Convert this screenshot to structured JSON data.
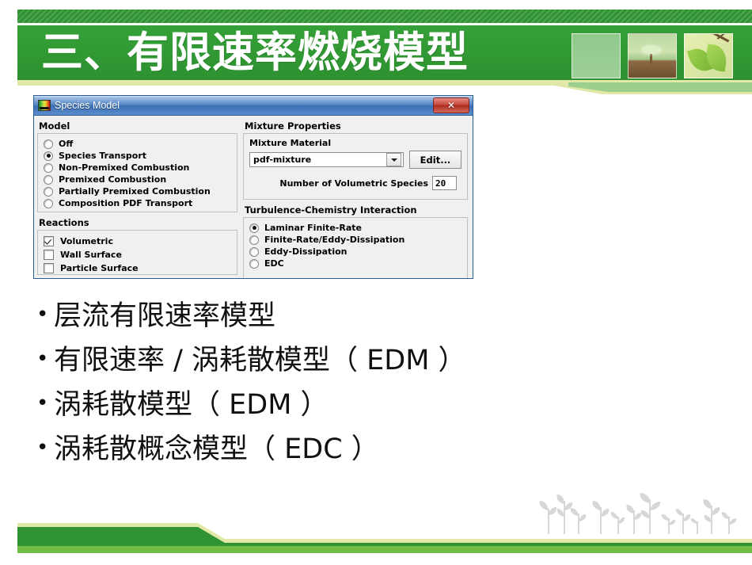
{
  "slide": {
    "title": "三、有限速率燃烧模型",
    "thumbnails": [
      {
        "name": "blank-panel"
      },
      {
        "name": "seedling-photo"
      },
      {
        "name": "leaf-photo"
      }
    ]
  },
  "dialog": {
    "title": "Species Model",
    "icon": "fluent-contour-icon",
    "close_label": "✕",
    "model": {
      "group_label": "Model",
      "options": [
        {
          "label": "Off",
          "selected": false
        },
        {
          "label": "Species Transport",
          "selected": true
        },
        {
          "label": "Non-Premixed Combustion",
          "selected": false
        },
        {
          "label": "Premixed Combustion",
          "selected": false
        },
        {
          "label": "Partially Premixed Combustion",
          "selected": false
        },
        {
          "label": "Composition PDF Transport",
          "selected": false
        }
      ]
    },
    "reactions": {
      "group_label": "Reactions",
      "options": [
        {
          "label": "Volumetric",
          "checked": true
        },
        {
          "label": "Wall Surface",
          "checked": false
        },
        {
          "label": "Particle Surface",
          "checked": false
        }
      ]
    },
    "mixture_properties": {
      "group_label": "Mixture Properties",
      "material_label": "Mixture Material",
      "material_value": "pdf-mixture",
      "edit_button": "Edit...",
      "species_count_label": "Number of Volumetric Species",
      "species_count_value": "20"
    },
    "turbulence_chemistry": {
      "group_label": "Turbulence-Chemistry Interaction",
      "options": [
        {
          "label": "Laminar Finite-Rate",
          "selected": true
        },
        {
          "label": "Finite-Rate/Eddy-Dissipation",
          "selected": false
        },
        {
          "label": "Eddy-Dissipation",
          "selected": false
        },
        {
          "label": "EDC",
          "selected": false
        }
      ]
    }
  },
  "bullets": [
    {
      "marker": "•",
      "text": "层流有限速率模型"
    },
    {
      "marker": "•",
      "text": "有限速率 / 涡耗散模型（ EDM ）"
    },
    {
      "marker": "•",
      "text": "涡耗散模型（ EDM ）"
    },
    {
      "marker": "•",
      "text": "涡耗散概念模型（ EDC ）"
    }
  ],
  "colors": {
    "banner_green": "#2e9330",
    "banner_green_light": "#35a038",
    "cream": "#e2e8a8",
    "footer_light_green": "#72bd44",
    "dialog_title_blue": "#3b6db4",
    "close_red": "#a92d1f"
  }
}
